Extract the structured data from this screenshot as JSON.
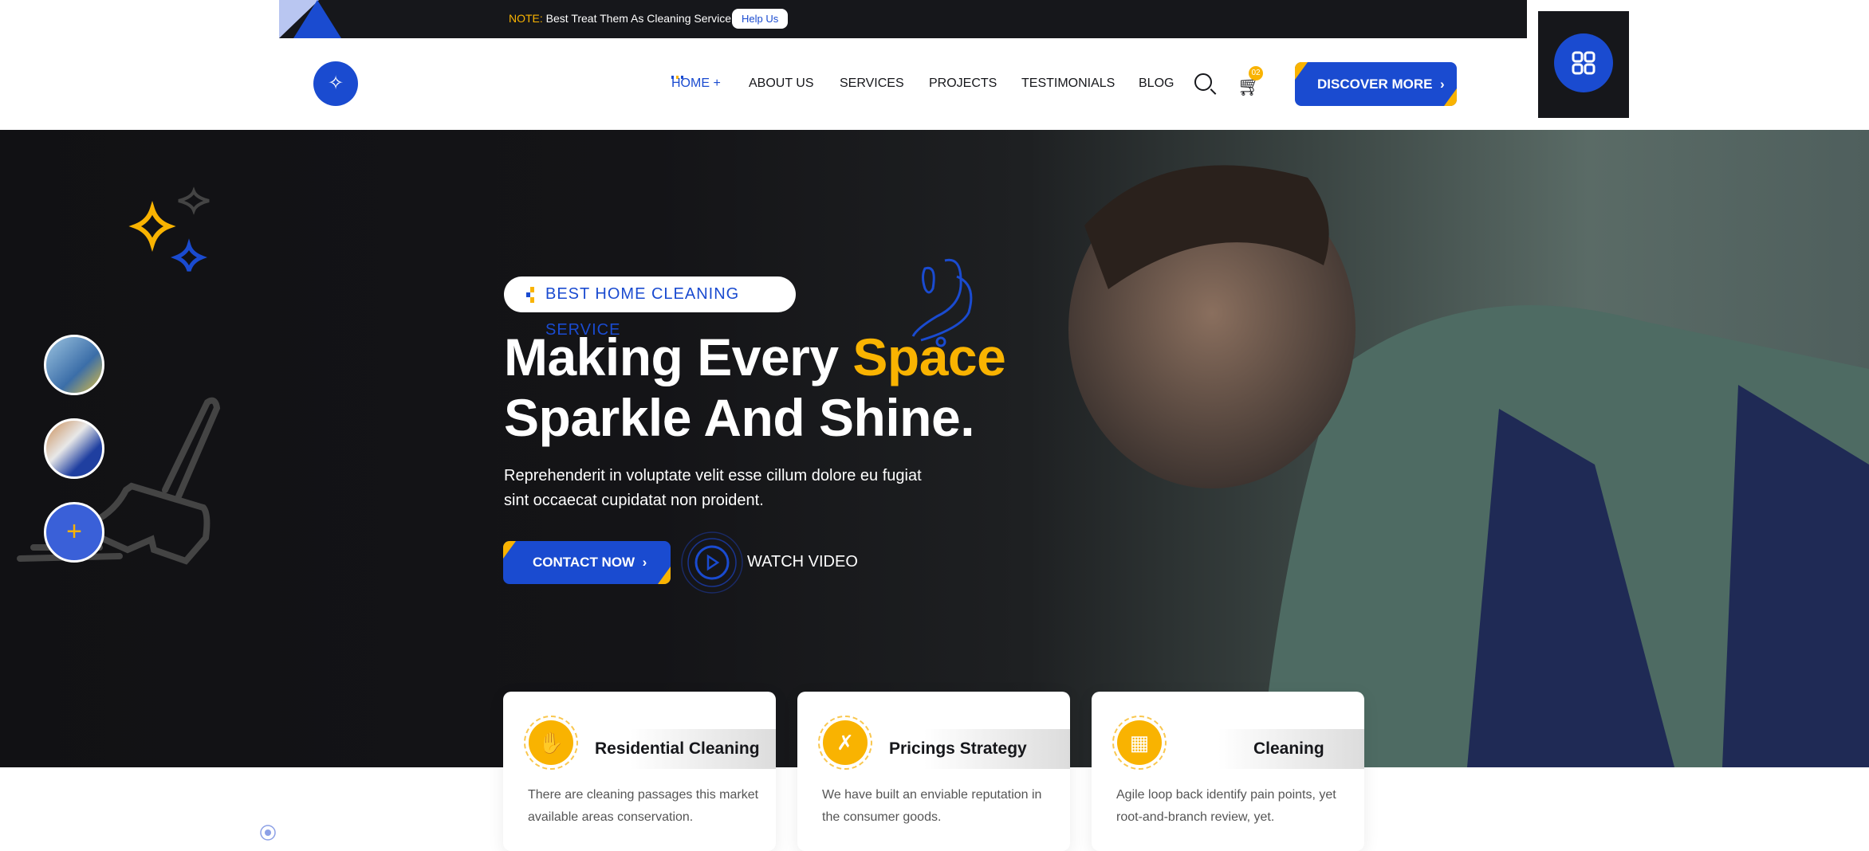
{
  "topbar": {
    "note_label": "NOTE:",
    "note_text": "Best Treat Them As Cleaning Service",
    "help_button": "Help Us"
  },
  "nav": {
    "items": [
      "HOME +",
      "ABOUT US",
      "SERVICES",
      "PROJECTS",
      "TESTIMONIALS",
      "BLOG"
    ],
    "cart_count": "02",
    "discover_button": "DISCOVER MORE"
  },
  "hero": {
    "badge": "BEST HOME CLEANING SERVICE",
    "title_part1": "Making Every ",
    "title_highlight": "Space",
    "title_line2": "Sparkle And Shine.",
    "paragraph": "Reprehenderit in voluptate velit esse cillum dolore eu fugiat sint occaecat cupidatat non proident.",
    "contact_button": "CONTACT NOW",
    "watch_video": "WATCH VIDEO",
    "thumb_plus": "+"
  },
  "cards": [
    {
      "title": "Residential Cleaning",
      "desc": "There are cleaning passages this market available areas conservation."
    },
    {
      "title": "Pricings Strategy",
      "desc": "We have built an enviable reputation in the consumer goods."
    },
    {
      "title": "Cleaning",
      "desc": "Agile loop back identify pain points, yet root-and-branch review, yet."
    }
  ],
  "colors": {
    "primary": "#1a4bd0",
    "accent": "#f9b301",
    "dark": "#16171b"
  }
}
